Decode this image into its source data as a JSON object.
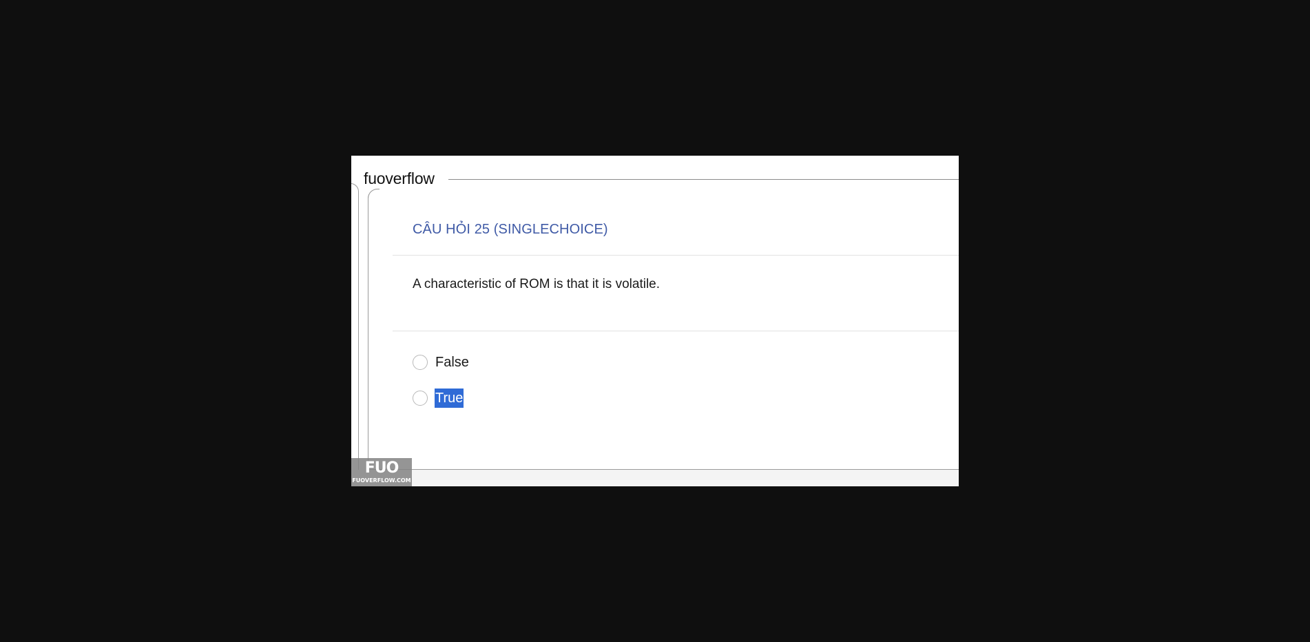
{
  "app": {
    "legend": "fuoverflow"
  },
  "question": {
    "title": "CÂU HỎI 25 (SINGLECHOICE)",
    "text": "A characteristic of ROM is that it is volatile.",
    "options": [
      {
        "label": "False",
        "selected": false,
        "highlighted": false
      },
      {
        "label": "True",
        "selected": false,
        "highlighted": true
      }
    ]
  },
  "watermark": {
    "logo": "FUO",
    "url": "FUOVERFLOW.COM"
  },
  "colors": {
    "background": "#0f0f0f",
    "title": "#3f5aa6",
    "highlight": "#2f6bd6"
  }
}
